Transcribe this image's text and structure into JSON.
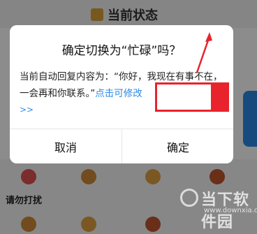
{
  "dialog": {
    "title": "确定切换为“忙碌”吗？",
    "message_prefix": "当前自动回复内容为：“你好，我现在有事不在，一会再和你联系。”",
    "message_link": "点击可修改",
    "more": ">>",
    "cancel_label": "取消",
    "confirm_label": "确定"
  },
  "background": {
    "title": "当前状态",
    "item_label": "请勿打扰"
  },
  "watermark": {
    "main": "当下软件园",
    "sub": "www.downxia.com"
  },
  "colors": {
    "link": "#2a8be8",
    "annotation": "#e8232b",
    "accent_blue": "#2a89e6"
  }
}
